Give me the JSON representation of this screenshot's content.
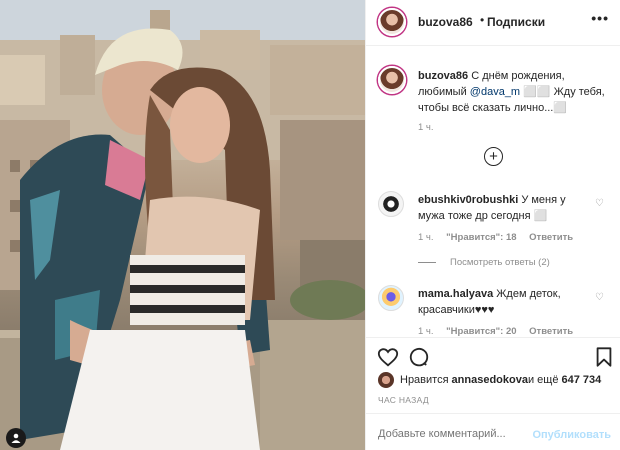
{
  "post": {
    "username": "buzova86",
    "dot": "•",
    "follow_label": "Подписки",
    "more": "•••"
  },
  "caption": {
    "username": "buzova86",
    "text_before": " С днём рождения, любимый ",
    "mention": "@dava_m",
    "text_after": " ⬜⬜ Жду тебя, чтобы всё сказать лично...⬜",
    "time": "1 ч.",
    "load_more": "+"
  },
  "comments": [
    {
      "username": "ebushkiv0robushki",
      "text": " У меня у мужа тоже др сегодня ⬜",
      "time": "1 ч.",
      "likes": "\"Нравится\": 18",
      "reply": "Ответить",
      "heart": "♡"
    },
    {
      "username": "mama.halyava",
      "text": " Ждем деток, красавчики♥♥♥",
      "time": "1 ч.",
      "likes": "\"Нравится\": 20",
      "reply": "Ответить",
      "heart": "♡"
    }
  ],
  "view_replies": "Посмотреть ответы (2)",
  "likes": {
    "prefix": "Нравится ",
    "user": "annasedokova",
    "suffix": " и ещё ",
    "count": "647 734"
  },
  "posted_ago": "ЧАС НАЗАД",
  "add_comment": {
    "placeholder": "Добавьте комментарий...",
    "publish_label": "Опубликовать"
  },
  "icons": {
    "like": "heart-icon",
    "comment": "comment-icon",
    "save": "bookmark-icon",
    "tag": "user-tag-icon"
  },
  "colors": {
    "text": "#262626",
    "meta": "#8e8e8e",
    "mention": "#00376b",
    "publish_disabled": "#b2dffc",
    "border": "#efefef"
  }
}
